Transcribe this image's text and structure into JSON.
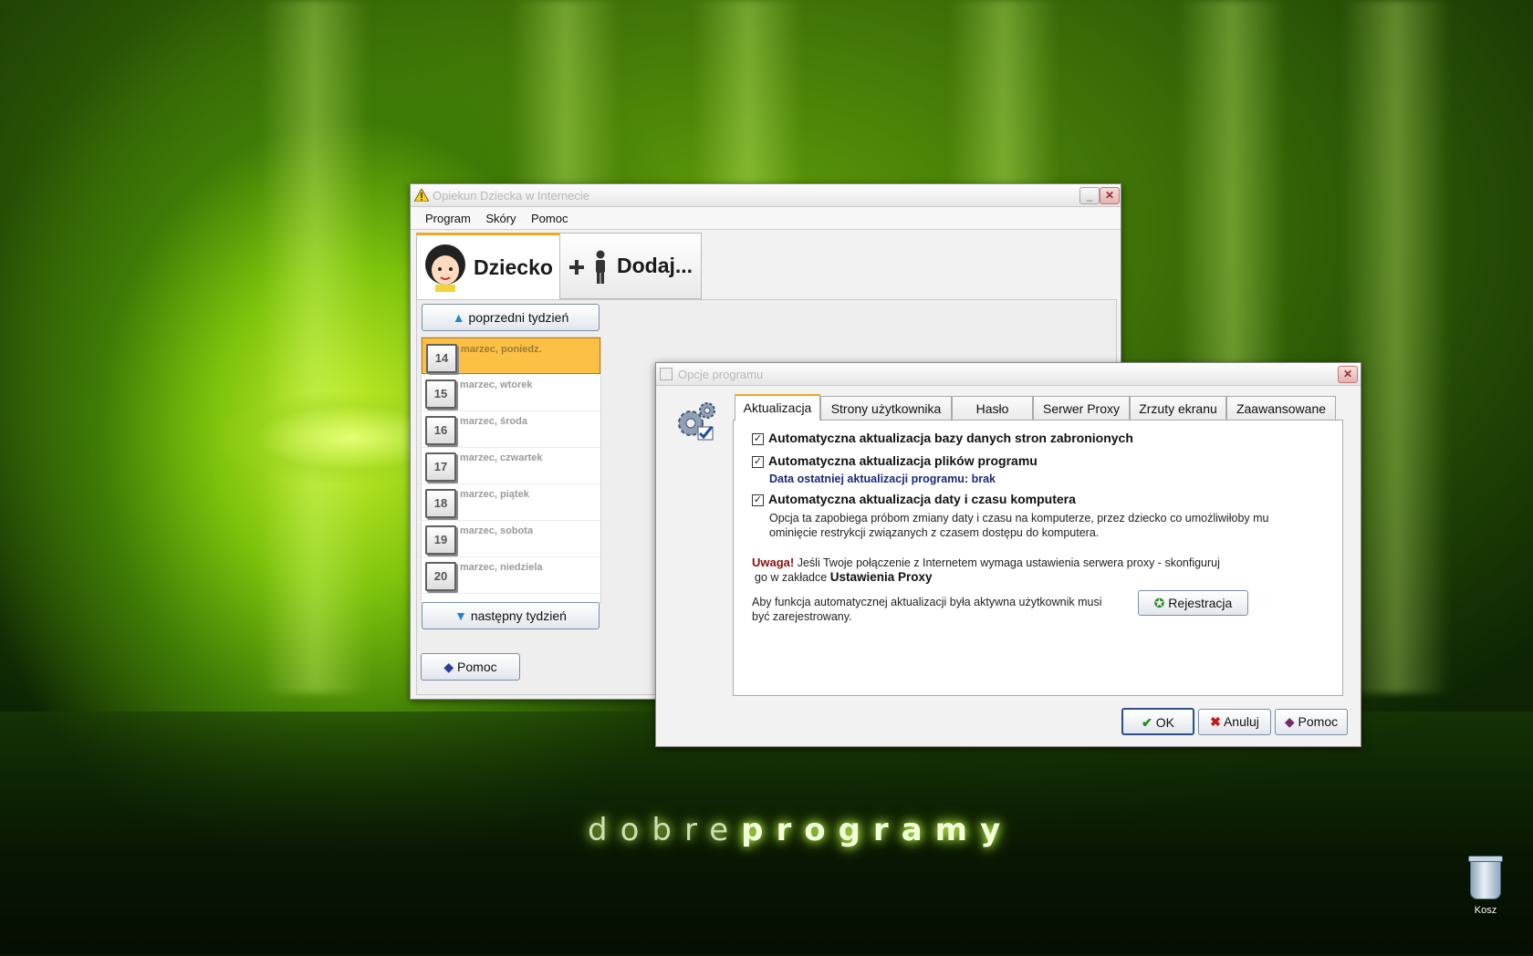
{
  "desktop": {
    "brand_light": "dobre",
    "brand_bold": "programy",
    "trash_label": "Kosz"
  },
  "main_window": {
    "title": "Opiekun Dziecka w Internecie",
    "menu": [
      "Program",
      "Skóry",
      "Pomoc"
    ],
    "tabs": {
      "child": "Dziecko",
      "add": "Dodaj..."
    },
    "prev_week": "poprzedni tydzień",
    "next_week": "następny tydzień",
    "help": "Pomoc",
    "days": [
      {
        "num": "14",
        "label": "marzec, poniedz."
      },
      {
        "num": "15",
        "label": "marzec, wtorek"
      },
      {
        "num": "16",
        "label": "marzec, środa"
      },
      {
        "num": "17",
        "label": "marzec, czwartek"
      },
      {
        "num": "18",
        "label": "marzec, piątek"
      },
      {
        "num": "19",
        "label": "marzec, sobota"
      },
      {
        "num": "20",
        "label": "marzec, niedziela"
      }
    ]
  },
  "options_dialog": {
    "title": "Opcje programu",
    "tabs": [
      "Aktualizacja",
      "Strony użytkownika",
      "Hasło",
      "Serwer Proxy",
      "Zrzuty ekranu",
      "Zaawansowane"
    ],
    "check1": "Automatyczna aktualizacja bazy danych stron zabronionych",
    "check2": "Automatyczna aktualizacja plików programu",
    "last_update": "Data ostatniej aktualizacji programu: brak",
    "check3": "Automatyczna aktualizacja daty i czasu komputera",
    "check3_desc_1": "Opcja ta zapobiega próbom zmiany daty i czasu na komputerze, przez dziecko co umożliwiłoby mu",
    "check3_desc_2": "ominięcie restrykcji związanych z czasem dostępu do komputera.",
    "warning_label": "Uwaga!",
    "warning_text_1": "Jeśli Twoje połączenie z Internetem wymaga ustawienia serwera proxy - skonfiguruj",
    "warning_text_2": "go w zakładce",
    "warning_link": "Ustawienia Proxy",
    "register_note_1": "Aby funkcja automatycznej aktualizacji była aktywna użytkownik musi",
    "register_note_2": "być zarejestrowany.",
    "register_button": "Rejestracja",
    "ok": "OK",
    "cancel": "Anuluj",
    "help": "Pomoc"
  }
}
